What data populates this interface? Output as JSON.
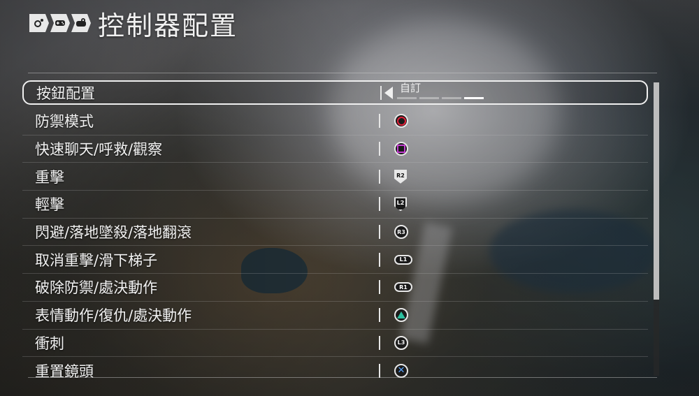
{
  "header": {
    "title": "控制器配置",
    "icons": [
      "settings-icon",
      "gamepad-icon",
      "controller-config-icon"
    ]
  },
  "selected_value": {
    "text": "自訂",
    "pages": 4,
    "current_page": 4
  },
  "rows": [
    {
      "label": "按鈕配置",
      "button": "value-selector"
    },
    {
      "label": "防禦模式",
      "button": "circle"
    },
    {
      "label": "快速聊天/呼救/觀察",
      "button": "square"
    },
    {
      "label": "重擊",
      "button": "R2"
    },
    {
      "label": "輕擊",
      "button": "L2"
    },
    {
      "label": "閃避/落地墜殺/落地翻滾",
      "button": "R3"
    },
    {
      "label": "取消重擊/滑下梯子",
      "button": "L1"
    },
    {
      "label": "破除防禦/處決動作",
      "button": "R1"
    },
    {
      "label": "表情動作/復仇/處決動作",
      "button": "triangle"
    },
    {
      "label": "衝刺",
      "button": "L3"
    },
    {
      "label": "重置鏡頭",
      "button": "cross"
    }
  ],
  "scrollbar": {
    "position_fraction": 0.0,
    "visible_fraction": 0.74
  },
  "colors": {
    "circle": "#e0213a",
    "square": "#c23fd0",
    "triangle": "#2bc0a0",
    "cross": "#5aa6ff",
    "text": "#f2f2f2"
  }
}
